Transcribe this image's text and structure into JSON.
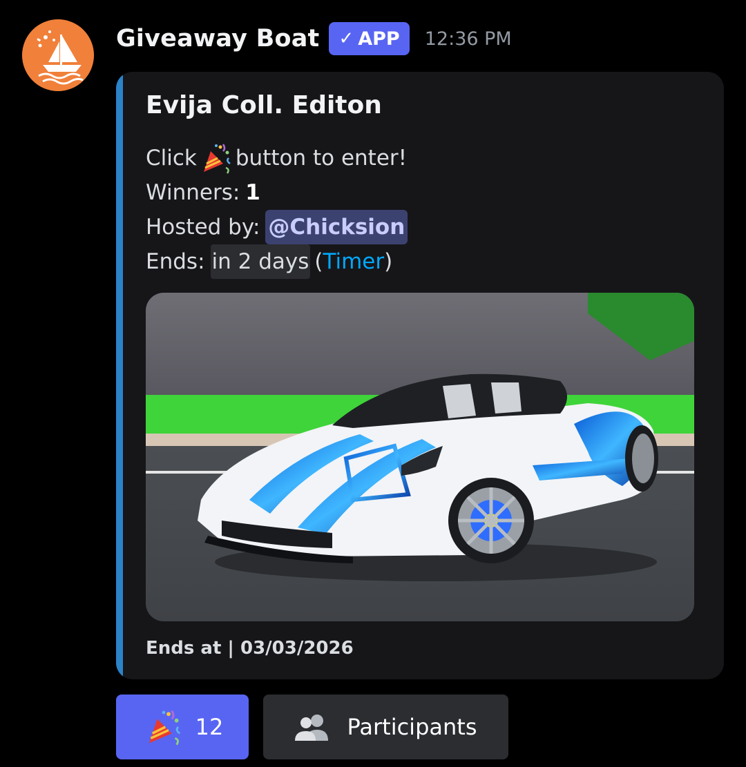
{
  "message": {
    "author": "Giveaway Boat",
    "badge": "APP",
    "badge_check": "✓",
    "timestamp": "12:36 PM",
    "avatar_icon": "sailboat-logo-icon"
  },
  "embed": {
    "accent_color": "#2b83c8",
    "title": "Evija Coll. Editon",
    "line1_before": "Click",
    "line1_after": "button to enter!",
    "winners_label": "Winners:",
    "winners_value": "1",
    "hosted_label": "Hosted by:",
    "host_mention": "@Chicksion",
    "ends_label": "Ends:",
    "ends_relative": "in 2 days",
    "open_paren": "(",
    "timer_link": "Timer",
    "close_paren": ")",
    "image_icon": "car-image",
    "footer": "Ends at | 03/03/2026"
  },
  "buttons": {
    "enter_icon": "party-popper-icon",
    "enter_count": "12",
    "participants_icon": "people-icon",
    "participants_label": "Participants"
  },
  "colors": {
    "blurple": "#5865f2",
    "embed_bg": "#161619",
    "link": "#00a8fc"
  }
}
